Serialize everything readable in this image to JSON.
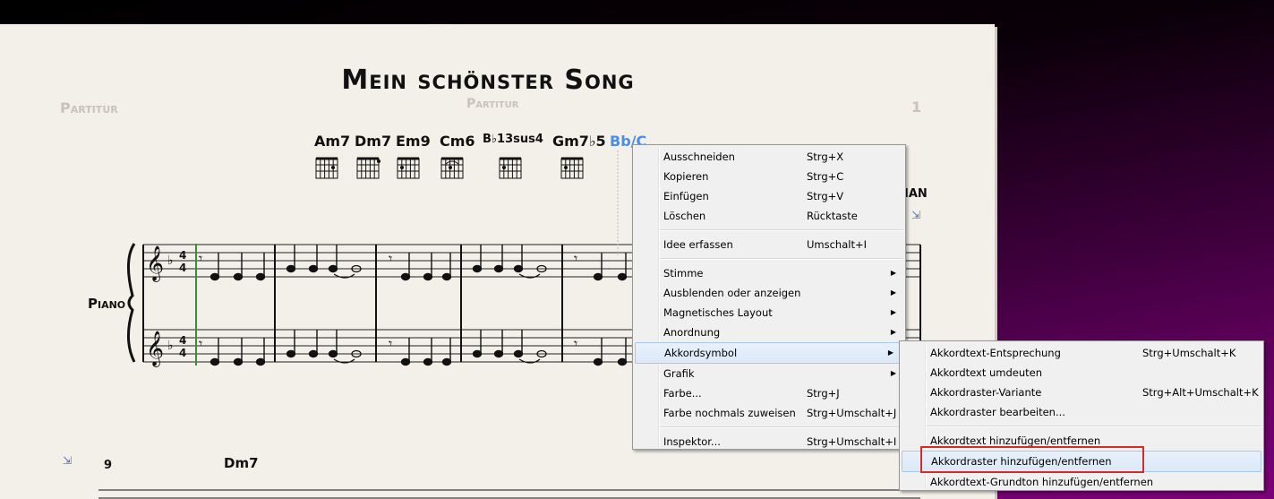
{
  "score": {
    "title": "Mein schönster Song",
    "header_left": "Partitur",
    "header_center": "Partitur",
    "page_number": "1",
    "instrument": "Piano",
    "right_label": "IAN",
    "bar_number": "9",
    "chords": [
      {
        "name": "Am7"
      },
      {
        "name": "Dm7"
      },
      {
        "name": "Em9"
      },
      {
        "name": "Cm6"
      },
      {
        "name": "B♭13sus4"
      },
      {
        "name": "Gm7♭5"
      },
      {
        "name": "Bb/C"
      }
    ],
    "lower_chord": "Dm7"
  },
  "context_menu": {
    "items": [
      {
        "label": "Ausschneiden",
        "shortcut": "Strg+X"
      },
      {
        "label": "Kopieren",
        "shortcut": "Strg+C"
      },
      {
        "label": "Einfügen",
        "shortcut": "Strg+V"
      },
      {
        "label": "Löschen",
        "shortcut": "Rücktaste"
      },
      {
        "label": "Idee erfassen",
        "shortcut": "Umschalt+I"
      },
      {
        "label": "Stimme",
        "shortcut": ""
      },
      {
        "label": "Ausblenden oder anzeigen",
        "shortcut": ""
      },
      {
        "label": "Magnetisches Layout",
        "shortcut": ""
      },
      {
        "label": "Anordnung",
        "shortcut": ""
      },
      {
        "label": "Akkordsymbol",
        "shortcut": ""
      },
      {
        "label": "Grafik",
        "shortcut": ""
      },
      {
        "label": "Farbe...",
        "shortcut": "Strg+J"
      },
      {
        "label": "Farbe nochmals zuweisen",
        "shortcut": "Strg+Umschalt+J"
      },
      {
        "label": "Inspektor...",
        "shortcut": "Strg+Umschalt+I"
      }
    ]
  },
  "submenu": {
    "items": [
      {
        "label": "Akkordtext-Entsprechung",
        "shortcut": "Strg+Umschalt+K"
      },
      {
        "label": "Akkordtext umdeuten",
        "shortcut": ""
      },
      {
        "label": "Akkordraster-Variante",
        "shortcut": "Strg+Alt+Umschalt+K"
      },
      {
        "label": "Akkordraster bearbeiten...",
        "shortcut": ""
      },
      {
        "label": "Akkordtext hinzufügen/entfernen",
        "shortcut": ""
      },
      {
        "label": "Akkordraster hinzufügen/entfernen",
        "shortcut": ""
      },
      {
        "label": "Akkordtext-Grundton hinzufügen/entfernen",
        "shortcut": ""
      }
    ]
  },
  "colors": {
    "selected_chord": "#4a8ee8",
    "focus_outline": "#d62b2b",
    "menu_bg": "#f0f0f0",
    "paper": "#f3efe9"
  }
}
